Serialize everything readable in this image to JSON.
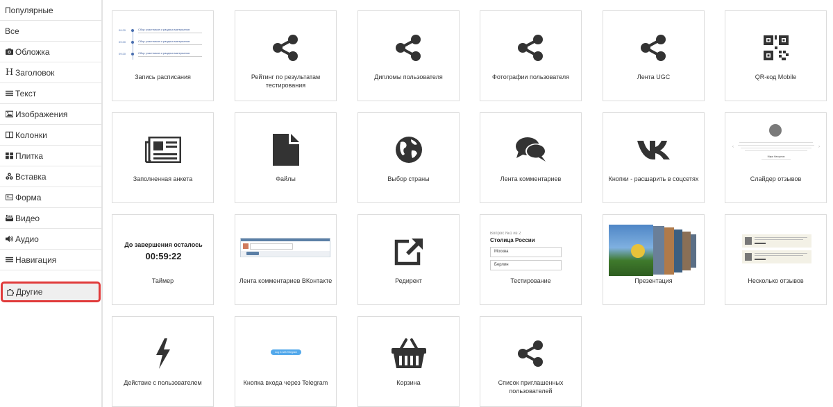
{
  "sidebar": {
    "items": [
      {
        "label": "Популярные",
        "icon": ""
      },
      {
        "label": "Все",
        "icon": ""
      },
      {
        "label": "Обложка",
        "icon": "camera-icon"
      },
      {
        "label": "Заголовок",
        "icon": "heading-icon"
      },
      {
        "label": "Текст",
        "icon": "text-lines-icon"
      },
      {
        "label": "Изображения",
        "icon": "image-icon"
      },
      {
        "label": "Колонки",
        "icon": "columns-icon"
      },
      {
        "label": "Плитка",
        "icon": "tiles-icon"
      },
      {
        "label": "Вставка",
        "icon": "cubes-icon"
      },
      {
        "label": "Форма",
        "icon": "form-icon"
      },
      {
        "label": "Видео",
        "icon": "youtube-icon"
      },
      {
        "label": "Аудио",
        "icon": "volume-icon"
      },
      {
        "label": "Навигация",
        "icon": "menu-icon"
      },
      {
        "label": "Другие",
        "icon": "puzzle-icon",
        "active": true
      }
    ]
  },
  "cards": [
    {
      "label": "Запись расписания",
      "icon": "schedule-preview"
    },
    {
      "label": "Рейтинг по результатам тестирования",
      "icon": "share-icon"
    },
    {
      "label": "Дипломы пользователя",
      "icon": "share-icon"
    },
    {
      "label": "Фотографии пользователя",
      "icon": "share-icon"
    },
    {
      "label": "Лента UGC",
      "icon": "share-icon"
    },
    {
      "label": "QR-код Mobile",
      "icon": "qrcode-icon"
    },
    {
      "label": "Заполненная анкета",
      "icon": "newspaper-icon"
    },
    {
      "label": "Файлы",
      "icon": "file-icon"
    },
    {
      "label": "Выбор страны",
      "icon": "globe-icon"
    },
    {
      "label": "Лента комментариев",
      "icon": "comments-icon"
    },
    {
      "label": "Кнопки - расшарить в соцсетях",
      "icon": "vk-icon"
    },
    {
      "label": "Слайдер отзывов",
      "icon": "reviews-slider-preview"
    },
    {
      "label": "Таймер",
      "icon": "timer-preview"
    },
    {
      "label": "Лента комментариев ВКонтакте",
      "icon": "vk-comments-preview"
    },
    {
      "label": "Редирект",
      "icon": "external-link-icon"
    },
    {
      "label": "Тестирование",
      "icon": "test-preview"
    },
    {
      "label": "Презентация",
      "icon": "presentation-preview"
    },
    {
      "label": "Несколько отзывов",
      "icon": "reviews-preview"
    },
    {
      "label": "Действие с пользователем",
      "icon": "bolt-icon"
    },
    {
      "label": "Кнопка входа через Telegram",
      "icon": "telegram-button-preview"
    },
    {
      "label": "Корзина",
      "icon": "basket-icon"
    },
    {
      "label": "Список приглашенных пользователей",
      "icon": "share-icon"
    }
  ],
  "previews": {
    "schedule": {
      "times": [
        "09:20",
        "09:20",
        "09:20"
      ],
      "titles": [
        "Сбор участников и раздача материалов",
        "Сбор участников и раздача материалов",
        "Сбор участников и раздача материалов"
      ]
    },
    "timer": {
      "title": "До завершения осталось",
      "value": "00:59:22"
    },
    "test": {
      "question_no": "Вопрос №1 из 2",
      "question": "Столица России",
      "options": [
        "Москва",
        "Берлин"
      ]
    },
    "reviews_slider": {
      "name": "Марк Нагорнов"
    },
    "telegram": {
      "button": "Log in with Telegram"
    }
  },
  "colors": {
    "active_border": "#e03a3a",
    "icon": "#333333",
    "card_border": "#dcdcdc"
  }
}
